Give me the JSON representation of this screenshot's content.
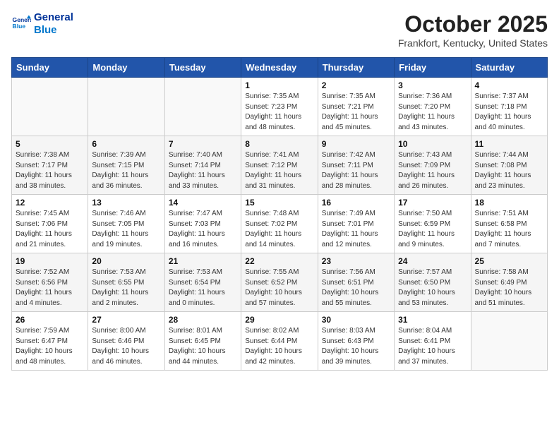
{
  "header": {
    "logo_line1": "General",
    "logo_line2": "Blue",
    "title": "October 2025",
    "subtitle": "Frankfort, Kentucky, United States"
  },
  "days_of_week": [
    "Sunday",
    "Monday",
    "Tuesday",
    "Wednesday",
    "Thursday",
    "Friday",
    "Saturday"
  ],
  "weeks": [
    [
      {
        "num": "",
        "info": ""
      },
      {
        "num": "",
        "info": ""
      },
      {
        "num": "",
        "info": ""
      },
      {
        "num": "1",
        "info": "Sunrise: 7:35 AM\nSunset: 7:23 PM\nDaylight: 11 hours\nand 48 minutes."
      },
      {
        "num": "2",
        "info": "Sunrise: 7:35 AM\nSunset: 7:21 PM\nDaylight: 11 hours\nand 45 minutes."
      },
      {
        "num": "3",
        "info": "Sunrise: 7:36 AM\nSunset: 7:20 PM\nDaylight: 11 hours\nand 43 minutes."
      },
      {
        "num": "4",
        "info": "Sunrise: 7:37 AM\nSunset: 7:18 PM\nDaylight: 11 hours\nand 40 minutes."
      }
    ],
    [
      {
        "num": "5",
        "info": "Sunrise: 7:38 AM\nSunset: 7:17 PM\nDaylight: 11 hours\nand 38 minutes."
      },
      {
        "num": "6",
        "info": "Sunrise: 7:39 AM\nSunset: 7:15 PM\nDaylight: 11 hours\nand 36 minutes."
      },
      {
        "num": "7",
        "info": "Sunrise: 7:40 AM\nSunset: 7:14 PM\nDaylight: 11 hours\nand 33 minutes."
      },
      {
        "num": "8",
        "info": "Sunrise: 7:41 AM\nSunset: 7:12 PM\nDaylight: 11 hours\nand 31 minutes."
      },
      {
        "num": "9",
        "info": "Sunrise: 7:42 AM\nSunset: 7:11 PM\nDaylight: 11 hours\nand 28 minutes."
      },
      {
        "num": "10",
        "info": "Sunrise: 7:43 AM\nSunset: 7:09 PM\nDaylight: 11 hours\nand 26 minutes."
      },
      {
        "num": "11",
        "info": "Sunrise: 7:44 AM\nSunset: 7:08 PM\nDaylight: 11 hours\nand 23 minutes."
      }
    ],
    [
      {
        "num": "12",
        "info": "Sunrise: 7:45 AM\nSunset: 7:06 PM\nDaylight: 11 hours\nand 21 minutes."
      },
      {
        "num": "13",
        "info": "Sunrise: 7:46 AM\nSunset: 7:05 PM\nDaylight: 11 hours\nand 19 minutes."
      },
      {
        "num": "14",
        "info": "Sunrise: 7:47 AM\nSunset: 7:03 PM\nDaylight: 11 hours\nand 16 minutes."
      },
      {
        "num": "15",
        "info": "Sunrise: 7:48 AM\nSunset: 7:02 PM\nDaylight: 11 hours\nand 14 minutes."
      },
      {
        "num": "16",
        "info": "Sunrise: 7:49 AM\nSunset: 7:01 PM\nDaylight: 11 hours\nand 12 minutes."
      },
      {
        "num": "17",
        "info": "Sunrise: 7:50 AM\nSunset: 6:59 PM\nDaylight: 11 hours\nand 9 minutes."
      },
      {
        "num": "18",
        "info": "Sunrise: 7:51 AM\nSunset: 6:58 PM\nDaylight: 11 hours\nand 7 minutes."
      }
    ],
    [
      {
        "num": "19",
        "info": "Sunrise: 7:52 AM\nSunset: 6:56 PM\nDaylight: 11 hours\nand 4 minutes."
      },
      {
        "num": "20",
        "info": "Sunrise: 7:53 AM\nSunset: 6:55 PM\nDaylight: 11 hours\nand 2 minutes."
      },
      {
        "num": "21",
        "info": "Sunrise: 7:53 AM\nSunset: 6:54 PM\nDaylight: 11 hours\nand 0 minutes."
      },
      {
        "num": "22",
        "info": "Sunrise: 7:55 AM\nSunset: 6:52 PM\nDaylight: 10 hours\nand 57 minutes."
      },
      {
        "num": "23",
        "info": "Sunrise: 7:56 AM\nSunset: 6:51 PM\nDaylight: 10 hours\nand 55 minutes."
      },
      {
        "num": "24",
        "info": "Sunrise: 7:57 AM\nSunset: 6:50 PM\nDaylight: 10 hours\nand 53 minutes."
      },
      {
        "num": "25",
        "info": "Sunrise: 7:58 AM\nSunset: 6:49 PM\nDaylight: 10 hours\nand 51 minutes."
      }
    ],
    [
      {
        "num": "26",
        "info": "Sunrise: 7:59 AM\nSunset: 6:47 PM\nDaylight: 10 hours\nand 48 minutes."
      },
      {
        "num": "27",
        "info": "Sunrise: 8:00 AM\nSunset: 6:46 PM\nDaylight: 10 hours\nand 46 minutes."
      },
      {
        "num": "28",
        "info": "Sunrise: 8:01 AM\nSunset: 6:45 PM\nDaylight: 10 hours\nand 44 minutes."
      },
      {
        "num": "29",
        "info": "Sunrise: 8:02 AM\nSunset: 6:44 PM\nDaylight: 10 hours\nand 42 minutes."
      },
      {
        "num": "30",
        "info": "Sunrise: 8:03 AM\nSunset: 6:43 PM\nDaylight: 10 hours\nand 39 minutes."
      },
      {
        "num": "31",
        "info": "Sunrise: 8:04 AM\nSunset: 6:41 PM\nDaylight: 10 hours\nand 37 minutes."
      },
      {
        "num": "",
        "info": ""
      }
    ]
  ]
}
